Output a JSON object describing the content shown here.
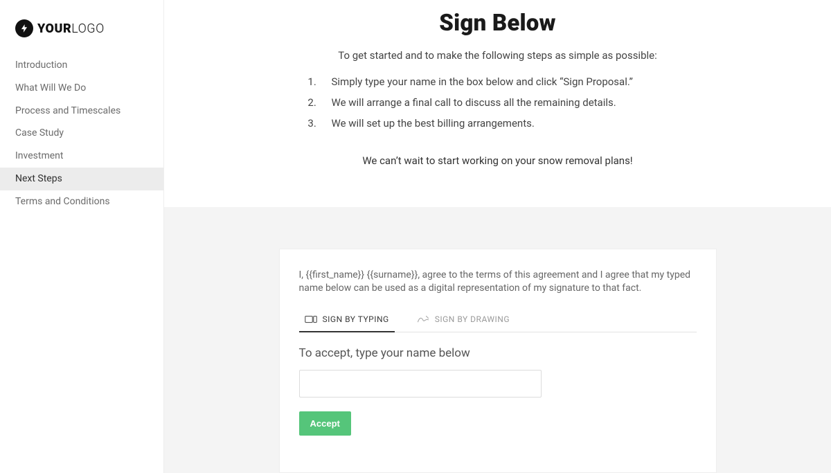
{
  "logo": {
    "bold": "YOUR",
    "light": "LOGO"
  },
  "sidebar": {
    "items": [
      {
        "label": "Introduction"
      },
      {
        "label": "What Will We Do"
      },
      {
        "label": "Process and Timescales"
      },
      {
        "label": "Case Study"
      },
      {
        "label": "Investment"
      },
      {
        "label": "Next Steps"
      },
      {
        "label": "Terms and Conditions"
      }
    ],
    "active_index": 5
  },
  "header": {
    "title": "Sign Below"
  },
  "intro": "To get started and to make the following steps as simple as possible:",
  "steps": [
    "Simply type your name in the box below and click “Sign Proposal.”",
    "We will arrange a final call to discuss all the remaining details.",
    "We will set up the best billing arrangements."
  ],
  "closing": "We can’t wait to start working on your snow removal plans!",
  "sign": {
    "agreement": "I, {{first_name}} {{surname}}, agree to the terms of this agreement and I agree that my typed name below can be used as a digital representation of my signature to that fact.",
    "tabs": {
      "typing": "SIGN BY TYPING",
      "drawing": "SIGN BY DRAWING"
    },
    "accept_label": "To accept, type your name below",
    "input_value": "",
    "button": "Accept"
  }
}
